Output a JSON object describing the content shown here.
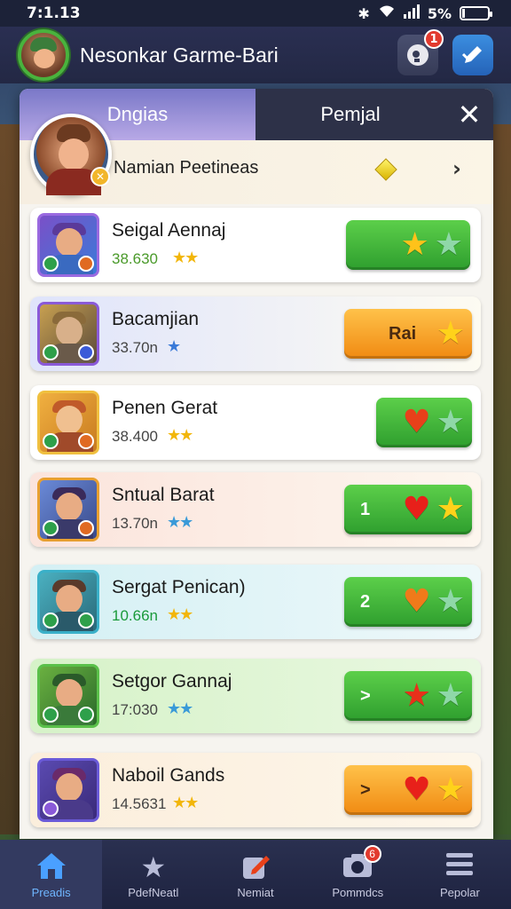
{
  "status": {
    "time": "7:1.13",
    "battery": "5%"
  },
  "header": {
    "title": "Nesonkar Garme-Bari",
    "notif_count": "1"
  },
  "tabs": {
    "active": "Dngias",
    "inactive": "Pemjal",
    "close": "✕"
  },
  "profile": {
    "name": "Namian Peetineas"
  },
  "rows": [
    {
      "name": "Seigal Aennaj",
      "score": "38.630",
      "stars": "★★",
      "label": "",
      "sym1": "★",
      "sym2": "★",
      "color": "green"
    },
    {
      "name": "Bacamjian",
      "score": "33.70n",
      "stars": "★",
      "label": "Rai",
      "sym1": "★",
      "sym2": "",
      "color": "orange"
    },
    {
      "name": "Penen Gerat",
      "score": "38.400",
      "stars": "★★",
      "label": "",
      "sym1": "♥",
      "sym2": "★",
      "color": "green"
    },
    {
      "name": "Sntual Barat",
      "score": "13.70n",
      "stars": "★★",
      "label": "1",
      "sym1": "♥",
      "sym2": "★",
      "color": "green"
    },
    {
      "name": "Sergat Penican)",
      "score": "10.66n",
      "stars": "★★",
      "label": "2",
      "sym1": "♥",
      "sym2": "★",
      "color": "green"
    },
    {
      "name": "Setgor Gannaj",
      "score": "17:030",
      "stars": "★★",
      "label": ">",
      "sym1": "★",
      "sym2": "★",
      "color": "green"
    },
    {
      "name": "Naboil Gands",
      "score": "14.5631",
      "stars": "★★",
      "label": ">",
      "sym1": "♥",
      "sym2": "★",
      "color": "orange"
    }
  ],
  "nav": [
    {
      "label": "Preadis",
      "icon": "home-icon"
    },
    {
      "label": "PdefNeatl",
      "icon": "star-icon"
    },
    {
      "label": "Nemiat",
      "icon": "edit-icon"
    },
    {
      "label": "Pommdcs",
      "icon": "camera-icon",
      "badge": "6"
    },
    {
      "label": "Pepolar",
      "icon": "menu-icon"
    }
  ],
  "colors": {
    "accent": "#5ccf4a",
    "orange": "#f08a12",
    "nav_active": "#6fb6ff"
  }
}
